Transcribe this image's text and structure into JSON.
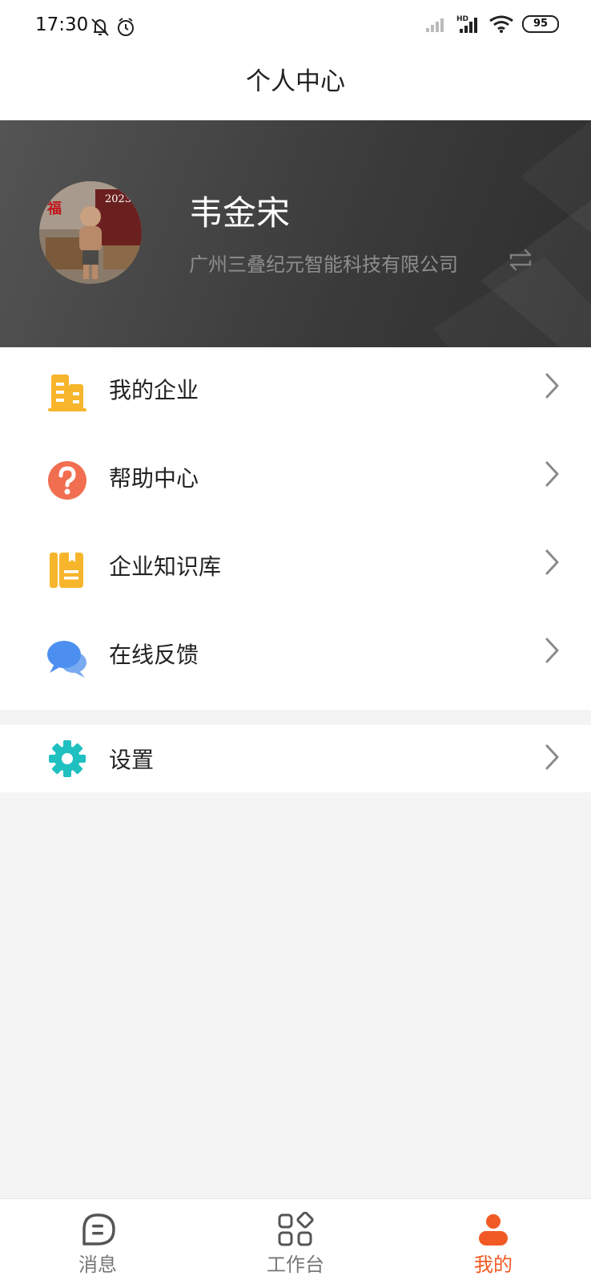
{
  "status_bar": {
    "time": "17:30",
    "battery": "95"
  },
  "header": {
    "title": "个人中心"
  },
  "profile": {
    "name": "韦金宋",
    "company": "广州三叠纪元智能科技有限公司"
  },
  "menu": [
    {
      "label": "我的企业",
      "icon": "building-icon"
    },
    {
      "label": "帮助中心",
      "icon": "question-icon"
    },
    {
      "label": "企业知识库",
      "icon": "notebook-icon"
    },
    {
      "label": "在线反馈",
      "icon": "chat-bubbles-icon"
    }
  ],
  "menu2": [
    {
      "label": "设置",
      "icon": "gear-icon"
    }
  ],
  "tabs": [
    {
      "label": "消息",
      "icon": "message-icon",
      "active": false
    },
    {
      "label": "工作台",
      "icon": "workbench-icon",
      "active": false
    },
    {
      "label": "我的",
      "icon": "person-icon",
      "active": true
    }
  ],
  "colors": {
    "accent": "#f15a24",
    "banner": "#3b3b3b"
  }
}
